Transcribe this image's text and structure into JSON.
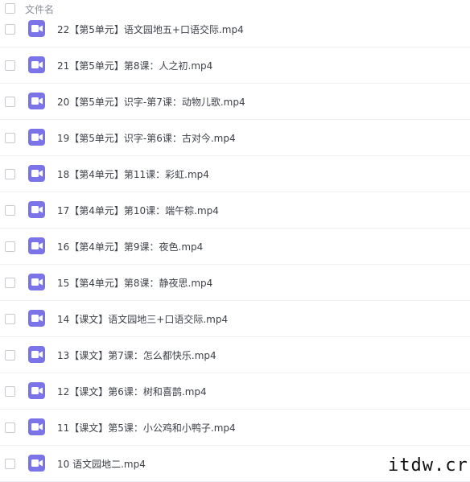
{
  "header": {
    "column_label": "文件名"
  },
  "files": [
    {
      "name": "22【第5单元】语文园地五+口语交际.mp4",
      "icon": "video-file-icon"
    },
    {
      "name": "21【第5单元】第8课：人之初.mp4",
      "icon": "video-file-icon"
    },
    {
      "name": "20【第5单元】识字-第7课：动物儿歌.mp4",
      "icon": "video-file-icon"
    },
    {
      "name": "19【第5单元】识字-第6课：古对今.mp4",
      "icon": "video-file-icon"
    },
    {
      "name": "18【第4单元】第11课：彩虹.mp4",
      "icon": "video-file-icon"
    },
    {
      "name": "17【第4单元】第10课：端午粽.mp4",
      "icon": "video-file-icon"
    },
    {
      "name": "16【第4单元】第9课：夜色.mp4",
      "icon": "video-file-icon"
    },
    {
      "name": "15【第4单元】第8课：静夜思.mp4",
      "icon": "video-file-icon"
    },
    {
      "name": "14【课文】语文园地三+口语交际.mp4",
      "icon": "video-file-icon"
    },
    {
      "name": "13【课文】第7课：怎么都快乐.mp4",
      "icon": "video-file-icon"
    },
    {
      "name": "12【课文】第6课：树和喜鹊.mp4",
      "icon": "video-file-icon"
    },
    {
      "name": "11【课文】第5课：小公鸡和小鸭子.mp4",
      "icon": "video-file-icon"
    },
    {
      "name": "10 语文园地二.mp4",
      "icon": "video-file-icon"
    }
  ],
  "watermark": "itdw.cr",
  "colors": {
    "icon_bg": "#7b74e8",
    "text": "#3d4148",
    "header_text": "#8a8f99"
  }
}
